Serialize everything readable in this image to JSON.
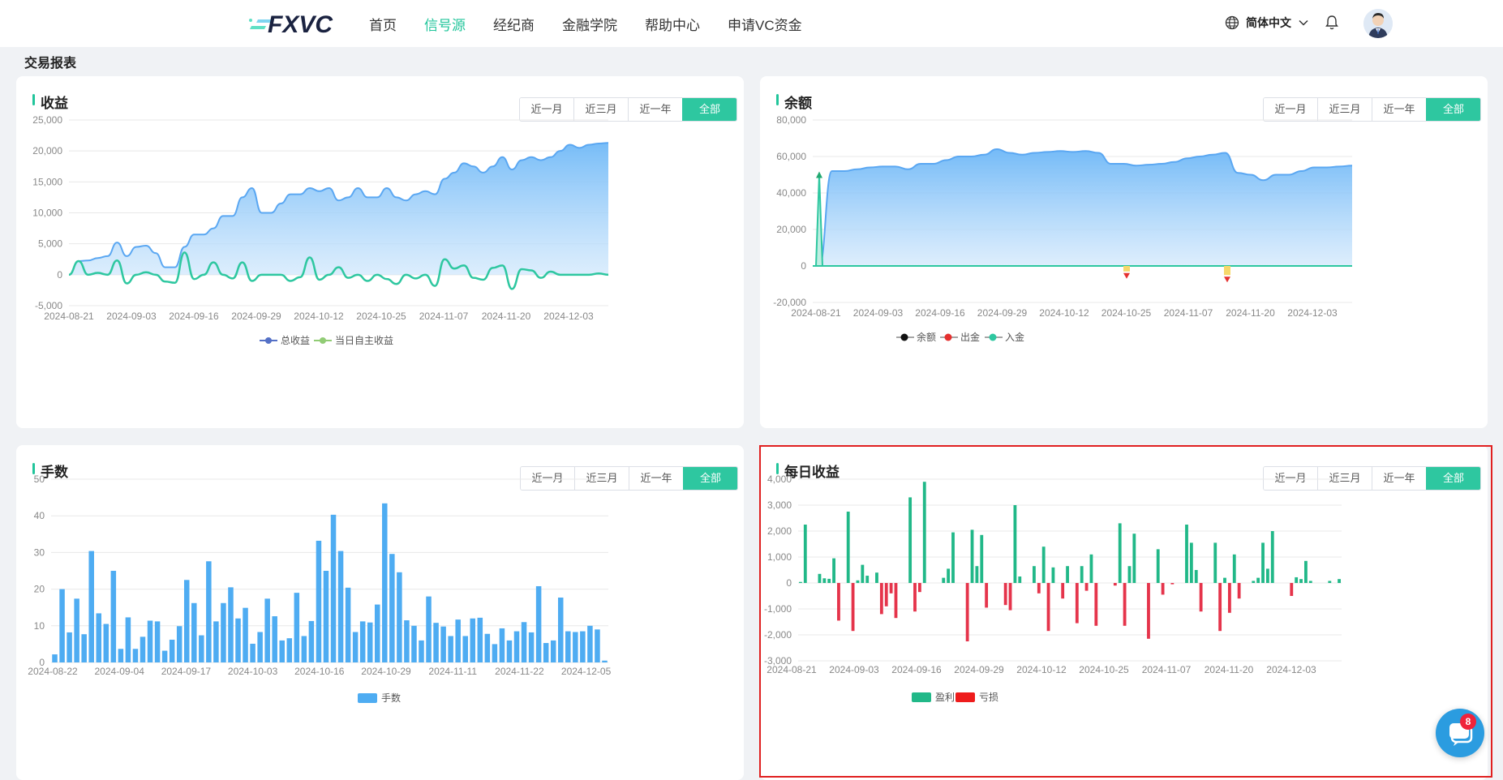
{
  "brand": {
    "logo_text": "FXVC",
    "accent": "#21c59b"
  },
  "nav": {
    "items": [
      {
        "label": "首页",
        "active": false
      },
      {
        "label": "信号源",
        "active": true
      },
      {
        "label": "经纪商",
        "active": false
      },
      {
        "label": "金融学院",
        "active": false
      },
      {
        "label": "帮助中心",
        "active": false
      },
      {
        "label": "申请VC资金",
        "active": false
      }
    ],
    "language": "简体中文",
    "icons": {
      "language": "globe-icon",
      "dropdown": "chevron-down-icon",
      "notification": "bell-icon",
      "avatar": "user-avatar"
    }
  },
  "page": {
    "section_title": "交易报表"
  },
  "range_options": [
    "近一月",
    "近三月",
    "近一年",
    "全部"
  ],
  "range_selected": "全部",
  "chat": {
    "badge": "8",
    "icon": "chat-icon"
  },
  "chart_data": [
    {
      "id": "income",
      "title": "收益",
      "type": "area",
      "y_ticks": [
        "25,000",
        "20,000",
        "15,000",
        "10,000",
        "5,000",
        "0",
        "-5,000"
      ],
      "ylim": [
        -5000,
        25000
      ],
      "x_ticks": [
        "2024-08-21",
        "2024-09-03",
        "2024-09-16",
        "2024-09-29",
        "2024-10-12",
        "2024-10-25",
        "2024-11-07",
        "2024-11-20",
        "2024-12-03"
      ],
      "legend": [
        "总收益",
        "当日自主收益"
      ],
      "series": [
        {
          "name": "总收益",
          "color": "#5aa7f2",
          "values": [
            0,
            2200,
            2300,
            2700,
            3000,
            5200,
            3000,
            4500,
            4700,
            3500,
            1200,
            1200,
            4500,
            6500,
            6500,
            7500,
            9500,
            9500,
            12500,
            14000,
            10000,
            10000,
            11500,
            13000,
            13000,
            14000,
            13500,
            14000,
            12000,
            12500,
            14000,
            12500,
            12500,
            14000,
            12500,
            12000,
            13000,
            13500,
            13000,
            15500,
            16500,
            18000,
            17500,
            16500,
            17500,
            19000,
            17000,
            18500,
            19000,
            18500,
            19000,
            20000,
            21000,
            20500,
            21000,
            21200,
            21300
          ]
        },
        {
          "name": "当日自主收益",
          "color": "#2ec7a0",
          "values": [
            0,
            2200,
            0,
            300,
            0,
            2300,
            -1400,
            0,
            400,
            0,
            -1100,
            -1300,
            3600,
            -700,
            0,
            2000,
            0,
            -600,
            2000,
            -1000,
            0,
            0,
            0,
            -1000,
            -400,
            2800,
            -800,
            0,
            1200,
            -500,
            0,
            -1000,
            0,
            -700,
            -1500,
            0,
            -600,
            0,
            -1800,
            2500,
            1000,
            1500,
            -500,
            -800,
            1100,
            1500,
            -2300,
            900,
            700,
            -500,
            500,
            0,
            0,
            0,
            0,
            200,
            0
          ]
        }
      ]
    },
    {
      "id": "balance",
      "title": "余额",
      "type": "area",
      "y_ticks": [
        "80,000",
        "60,000",
        "40,000",
        "20,000",
        "0",
        "-20,000"
      ],
      "ylim": [
        -20000,
        80000
      ],
      "x_ticks": [
        "2024-08-21",
        "2024-09-03",
        "2024-09-16",
        "2024-09-29",
        "2024-10-12",
        "2024-10-25",
        "2024-11-07",
        "2024-11-20",
        "2024-12-03"
      ],
      "legend": [
        "余额",
        "出金",
        "入金"
      ],
      "series": [
        {
          "name": "余额",
          "color": "#5aa7f2",
          "values": [
            0,
            52000,
            52000,
            53000,
            54000,
            54500,
            54500,
            53000,
            56000,
            56000,
            58000,
            60000,
            60000,
            61000,
            64000,
            62000,
            61000,
            62000,
            62500,
            63000,
            62500,
            63000,
            62000,
            56000,
            56000,
            55000,
            55500,
            56000,
            57000,
            59000,
            60000,
            61000,
            62000,
            51000,
            50000,
            47000,
            50000,
            50000,
            52000,
            54000,
            54000,
            54500,
            55000
          ]
        },
        {
          "name": "入金",
          "color": "#2ec7a0",
          "values": [
            50000
          ]
        },
        {
          "name": "出金",
          "color": "#e5302f",
          "values": [
            -3000,
            -5000
          ]
        }
      ]
    },
    {
      "id": "lots",
      "title": "手数",
      "type": "bar",
      "y_ticks": [
        "50",
        "40",
        "30",
        "20",
        "10",
        "0"
      ],
      "ylim": [
        0,
        50
      ],
      "x_ticks": [
        "2024-08-22",
        "2024-09-04",
        "2024-09-17",
        "2024-10-03",
        "2024-10-16",
        "2024-10-29",
        "2024-11-11",
        "2024-11-22",
        "2024-12-05"
      ],
      "legend": [
        "手数"
      ],
      "series": [
        {
          "name": "手数",
          "color": "#4eacf2",
          "values": [
            2.2,
            20,
            8.2,
            17.4,
            7.7,
            30.4,
            13.4,
            10.5,
            25,
            3.7,
            12.3,
            3.7,
            7,
            11.4,
            11.2,
            3.2,
            6.2,
            9.9,
            22.5,
            16.2,
            7.4,
            27.6,
            11.2,
            16.2,
            20.5,
            12,
            14.9,
            5.1,
            8.3,
            17.4,
            12.6,
            6,
            6.6,
            19,
            7.2,
            11.3,
            33.2,
            25,
            40.3,
            30.4,
            20.4,
            8.3,
            11.2,
            10.9,
            15.8,
            43.4,
            29.6,
            24.6,
            11.5,
            10,
            6,
            18,
            10.8,
            9.8,
            7.2,
            11.7,
            7.2,
            12,
            12.2,
            7.8,
            5,
            9.3,
            6,
            8.5,
            11,
            8.2,
            20.8,
            5.3,
            6,
            17.7,
            8.5,
            8.3,
            8.5,
            10,
            9,
            0.5
          ]
        }
      ]
    },
    {
      "id": "daily",
      "title": "每日收益",
      "type": "bar",
      "y_ticks": [
        "4,000",
        "3,000",
        "2,000",
        "1,000",
        "0",
        "-1,000",
        "-2,000",
        "-3,000"
      ],
      "ylim": [
        -3000,
        4000
      ],
      "x_ticks": [
        "2024-08-21",
        "2024-09-03",
        "2024-09-16",
        "2024-09-29",
        "2024-10-12",
        "2024-10-25",
        "2024-11-07",
        "2024-11-20",
        "2024-12-03"
      ],
      "legend": [
        "盈利",
        "亏损"
      ],
      "series": [
        {
          "name": "每日收益",
          "color_positive": "#21b888",
          "color_negative": "#e5344b",
          "values": [
            40,
            2250,
            0,
            0,
            350,
            180,
            160,
            950,
            -1450,
            0,
            2750,
            -1850,
            100,
            700,
            280,
            0,
            400,
            -1200,
            -900,
            -400,
            -1350,
            0,
            0,
            3300,
            -1100,
            -350,
            3900,
            0,
            0,
            0,
            200,
            550,
            1950,
            0,
            0,
            -2250,
            2050,
            650,
            1850,
            -950,
            0,
            0,
            0,
            -850,
            -1050,
            3000,
            250,
            0,
            0,
            650,
            -400,
            1400,
            -1850,
            600,
            0,
            -600,
            650,
            0,
            -1550,
            650,
            -300,
            1100,
            -1650,
            0,
            0,
            0,
            -100,
            2300,
            -1650,
            650,
            1900,
            0,
            0,
            -2150,
            0,
            1300,
            -450,
            0,
            -50,
            0,
            0,
            2250,
            1550,
            500,
            -1100,
            0,
            0,
            1550,
            -1850,
            200,
            -1150,
            1100,
            -600,
            0,
            0,
            80,
            200,
            1550,
            550,
            2000,
            0,
            0,
            0,
            -500,
            220,
            150,
            850,
            80,
            0,
            0,
            0,
            80,
            0,
            150
          ]
        }
      ]
    }
  ]
}
